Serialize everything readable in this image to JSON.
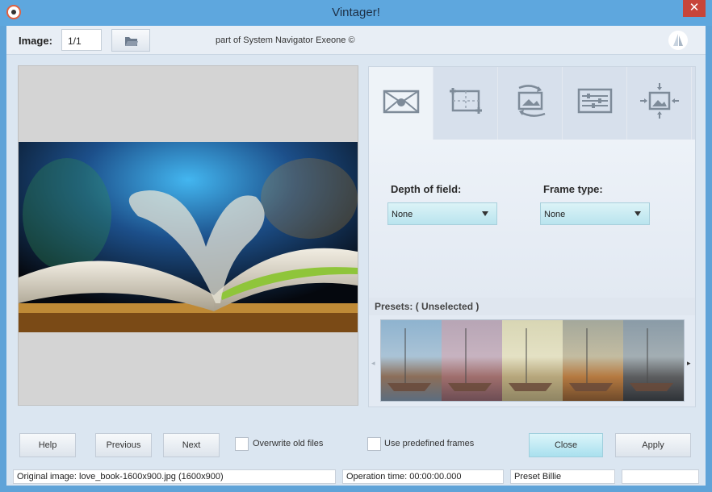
{
  "window": {
    "title": "Vintager!",
    "close_glyph": "✕",
    "app_icon": "vintager-app-icon"
  },
  "toolbar": {
    "image_label": "Image:",
    "image_value": "1/1",
    "open_folder_icon": "folder-open-icon",
    "part_of_text": "part of System Navigator Exeone ©",
    "brand_icon": "sail-logo-icon"
  },
  "tabs": [
    {
      "name": "frame-effects",
      "icon": "envelope-frame-icon",
      "active": true
    },
    {
      "name": "crop",
      "icon": "crop-icon",
      "active": false
    },
    {
      "name": "rotate",
      "icon": "rotate-image-icon",
      "active": false
    },
    {
      "name": "adjust",
      "icon": "sliders-icon",
      "active": false
    },
    {
      "name": "resize",
      "icon": "resize-image-icon",
      "active": false
    }
  ],
  "controls": {
    "depth_of_field_label": "Depth of field:",
    "depth_of_field_value": "None",
    "frame_type_label": "Frame type:",
    "frame_type_value": "None"
  },
  "presets": {
    "label": "Presets: ( Unselected )",
    "left_arrow": "◂",
    "right_arrow": "▸",
    "thumbs": [
      "preset-original",
      "preset-rose",
      "preset-faded",
      "preset-warm",
      "preset-dark"
    ]
  },
  "buttons": {
    "help": "Help",
    "previous": "Previous",
    "next": "Next",
    "overwrite_label": "Overwrite old files",
    "frames_label": "Use predefined frames",
    "close": "Close",
    "apply": "Apply"
  },
  "status": {
    "original": "Original image: love_book-1600x900.jpg (1600x900)",
    "operation_time": "Operation time: 00:00:00.000",
    "preset": "Preset Billie",
    "extra": ""
  },
  "colors": {
    "title_bar": "#5ea7de",
    "close_button": "#c7453a",
    "primary_button": "#bde8f2",
    "panel": "#dbe6f1"
  }
}
